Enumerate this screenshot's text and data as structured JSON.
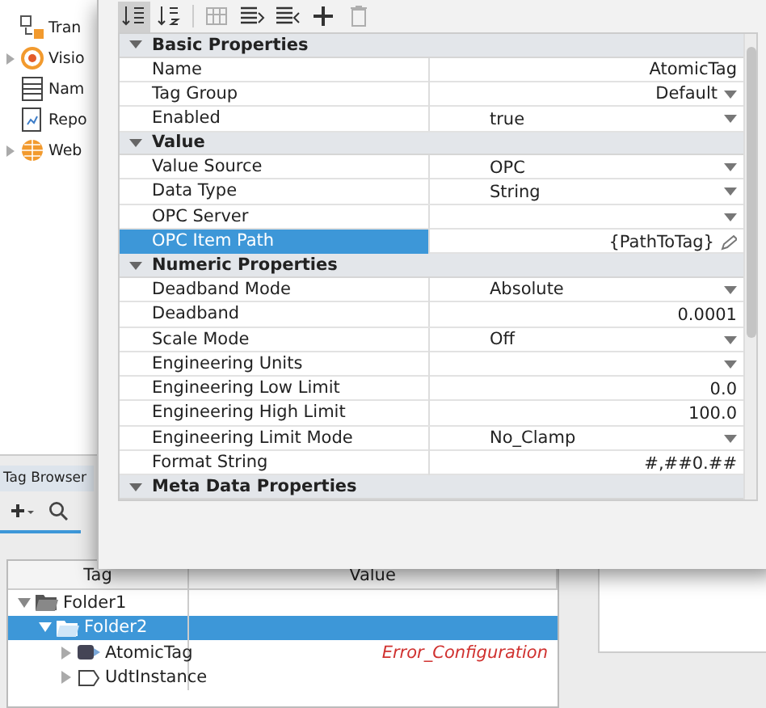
{
  "sidebar": {
    "items": [
      {
        "label": "Tran",
        "kind": "transfer",
        "expandable": false
      },
      {
        "label": "Visio",
        "kind": "vision",
        "expandable": true
      },
      {
        "label": "Nam",
        "kind": "named",
        "expandable": false
      },
      {
        "label": "Repo",
        "kind": "report",
        "expandable": false
      },
      {
        "label": "Web",
        "kind": "web",
        "expandable": true
      }
    ]
  },
  "tag_browser": {
    "title": "Tag Browser",
    "columns": [
      "Tag",
      "Value"
    ],
    "rows": [
      {
        "label": "Folder1",
        "kind": "folder",
        "expanded": true,
        "selected": false,
        "children": [
          {
            "label": "Folder2",
            "kind": "folder",
            "expanded": true,
            "selected": true,
            "children": [
              {
                "label": "AtomicTag",
                "kind": "tag",
                "expanded": false,
                "selected": false,
                "value": "Error_Configuration"
              },
              {
                "label": "UdtInstance",
                "kind": "udt",
                "expanded": false,
                "selected": false
              }
            ]
          }
        ]
      }
    ]
  },
  "dialog": {
    "toolbar": [
      {
        "kind": "sort-cat",
        "disabled": false,
        "selected": true
      },
      {
        "kind": "sort-az",
        "disabled": false,
        "selected": false
      },
      {
        "kind": "grid",
        "disabled": true,
        "selected": false
      },
      {
        "kind": "expand",
        "disabled": false,
        "selected": false
      },
      {
        "kind": "collapse",
        "disabled": false,
        "selected": false
      },
      {
        "kind": "plus",
        "disabled": false,
        "selected": false
      },
      {
        "kind": "trash",
        "disabled": true,
        "selected": false
      }
    ],
    "groups": [
      {
        "title": "Basic Properties",
        "expanded": true,
        "rows": [
          {
            "name": "Name",
            "value": "AtomicTag",
            "kind": "text",
            "selected": false
          },
          {
            "name": "Tag Group",
            "value": "Default",
            "kind": "combo",
            "selected": false
          },
          {
            "name": "Enabled",
            "value": "true",
            "kind": "select",
            "selected": false
          }
        ]
      },
      {
        "title": "Value",
        "expanded": true,
        "rows": [
          {
            "name": "Value Source",
            "value": "OPC",
            "kind": "select",
            "selected": false
          },
          {
            "name": "Data Type",
            "value": "String",
            "kind": "select",
            "selected": false
          },
          {
            "name": "OPC Server",
            "kind": "select",
            "selected": false
          },
          {
            "name": "OPC Item Path",
            "value": "{PathToTag}",
            "kind": "path",
            "selected": true
          }
        ]
      },
      {
        "title": "Numeric Properties",
        "expanded": true,
        "rows": [
          {
            "name": "Deadband Mode",
            "value": "Absolute",
            "kind": "select",
            "selected": false
          },
          {
            "name": "Deadband",
            "value": "0.0001",
            "kind": "text",
            "selected": false
          },
          {
            "name": "Scale Mode",
            "value": "Off",
            "kind": "select",
            "selected": false
          },
          {
            "name": "Engineering Units",
            "kind": "select",
            "selected": false
          },
          {
            "name": "Engineering Low Limit",
            "value": "0.0",
            "kind": "text",
            "selected": false
          },
          {
            "name": "Engineering High Limit",
            "value": "100.0",
            "kind": "text",
            "selected": false
          },
          {
            "name": "Engineering Limit Mode",
            "value": "No_Clamp",
            "kind": "select",
            "selected": false
          },
          {
            "name": "Format String",
            "value": "#,##0.##",
            "kind": "text",
            "selected": false
          }
        ]
      },
      {
        "title": "Meta Data Properties",
        "expanded": true
      }
    ]
  }
}
